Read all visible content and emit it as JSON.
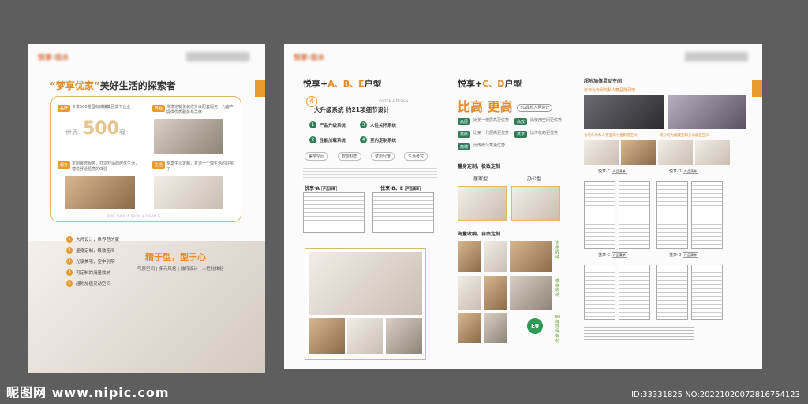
{
  "left_page": {
    "brand": "悦享·佰水",
    "headline_quote": "“梦享优家”",
    "headline_rest": "美好生活的探索者",
    "card_items": [
      {
        "label": "品牌",
        "text": "专享500强国有城镇集团旗下企业"
      },
      {
        "label": "专业",
        "text": "专享定制化装修升级配套服务，为客户提供优质服务与关怀"
      },
      {
        "label": "服务",
        "text": "定制装修服务，打造舒适的居住生活，营造舒适惬意的体验"
      },
      {
        "label": "生活",
        "text": "专享生活定制，打造一个理生活的好房子"
      }
    ],
    "world500_prefix": "世界",
    "world500_number": "500",
    "world500_suffix": "强",
    "card_footer": "MAKE THEM IN BEGIN A DREAM IS",
    "list_items": [
      "大师设计，世界范的家",
      "量身定制，极致空间",
      "光享美宅，空中别院",
      "可定制的海量收纳",
      "超附加值灵动空间"
    ],
    "slogan": "精于型，型于心",
    "sub_slogan": "气质空间 | 多元风格 | 独特设计 | 人性化体验"
  },
  "middle_page": {
    "brand": "悦享·佰水",
    "title_prefix": "悦享+",
    "title_types": "A、B、E",
    "title_suffix": "户型",
    "system_en": "SYSTEM & DESIGN",
    "system_number": "4",
    "system_title": "大升级系统 约21项细节设计",
    "systems": [
      {
        "n": "1",
        "label": "产品升级系统"
      },
      {
        "n": "3",
        "label": "人性关怀系统"
      },
      {
        "n": "2",
        "label": "性能加载系统"
      },
      {
        "n": "4",
        "label": "室内定制系统"
      }
    ],
    "pills": [
      "美学空间",
      "智能材质",
      "梦想尺度",
      "生活考究"
    ],
    "table_a": "悦享·A",
    "table_be": "悦享·B、E",
    "table_tag": "产品清单"
  },
  "right_page": {
    "brand": "悦享·佰水",
    "title_prefix": "悦享+",
    "title_types": "C、D",
    "title_suffix": "户型",
    "big_title_a": "比高",
    "big_title_b": "更高",
    "big_title_badge": "5G理想人居设计",
    "badges": [
      {
        "label": "高层",
        "text": "比第一但层高更优势"
      },
      {
        "label": "高效",
        "text": "比使用空间更优势"
      },
      {
        "label": "高级",
        "text": "比第一代层高更优势"
      },
      {
        "label": "高享",
        "text": "比传统的更优势"
      },
      {
        "label": "高端",
        "text": "比传统公寓更优势"
      }
    ],
    "section_custom": "量身定制，极致定制",
    "home_type": "居家型",
    "office_type": "办公型",
    "storage_title": "海量收纳，自由定制",
    "side_labels": [
      "衣柜收纳",
      "楼梯收纳",
      "E0级环保板材"
    ],
    "extra_title": "超附加值灵动空间",
    "extra_sub": "可作为专属的私人藏品陈列馆",
    "extra_sub2": "也可作为私人茶室或小型影音空间",
    "extra_sub3": "或分切为储藏室和多功能区空间",
    "table_c": "悦享·C",
    "table_d": "悦享·D",
    "table_tag": "产品清单"
  },
  "watermark": "昵图网 www.nipic.com",
  "id_text": "ID:33331825 NO:20221020072816754123"
}
